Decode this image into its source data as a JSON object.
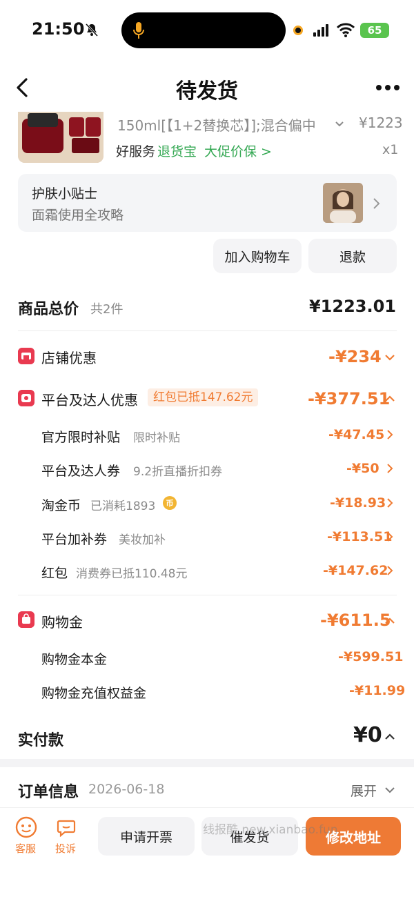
{
  "status_bar": {
    "time": "21:50",
    "battery": "65"
  },
  "nav": {
    "title": "待发货"
  },
  "product": {
    "spec": "150ml[【1+2替换芯】];混合偏中",
    "price": "¥1223",
    "service_good": "好服务",
    "service_return": "退货宝",
    "service_promo": "大促价保 >",
    "quantity": "x1"
  },
  "tips": {
    "title": "护肤小贴士",
    "subtitle": "面霜使用全攻略"
  },
  "actions": {
    "add_cart": "加入购物车",
    "refund": "退款"
  },
  "totals": {
    "label": "商品总价",
    "count": "共2件",
    "value": "¥1223.01"
  },
  "store_discount": {
    "label": "店铺优惠",
    "value": "-¥234"
  },
  "platform_discount": {
    "label": "平台及达人优惠",
    "badge": "红包已抵147.62元",
    "value": "-¥377.51",
    "items": [
      {
        "label": "官方限时补贴",
        "note": "限时补贴",
        "value": "-¥47.45"
      },
      {
        "label": "平台及达人券",
        "note": "9.2折直播折扣券",
        "value": "-¥50"
      },
      {
        "label": "淘金币",
        "note": "已消耗1893",
        "value": "-¥18.93"
      },
      {
        "label": "平台加补券",
        "note": "美妆加补",
        "value": "-¥113.51"
      },
      {
        "label": "红包",
        "note": "消费券已抵110.48元",
        "value": "-¥147.62"
      }
    ]
  },
  "shopping_money": {
    "label": "购物金",
    "value": "-¥611.5",
    "items": [
      {
        "label": "购物金本金",
        "value": "-¥599.51"
      },
      {
        "label": "购物金充值权益金",
        "value": "-¥11.99"
      }
    ]
  },
  "paid": {
    "label": "实付款",
    "value": "¥0"
  },
  "order_info": {
    "label": "订单信息",
    "date": "2026-06-18",
    "expand": "展开"
  },
  "bottom": {
    "customer_service": "客服",
    "complain": "投诉",
    "invoice": "申请开票",
    "urge": "催发货",
    "change_address": "修改地址",
    "watermark": "线报酷 new.xianbao.fun"
  }
}
